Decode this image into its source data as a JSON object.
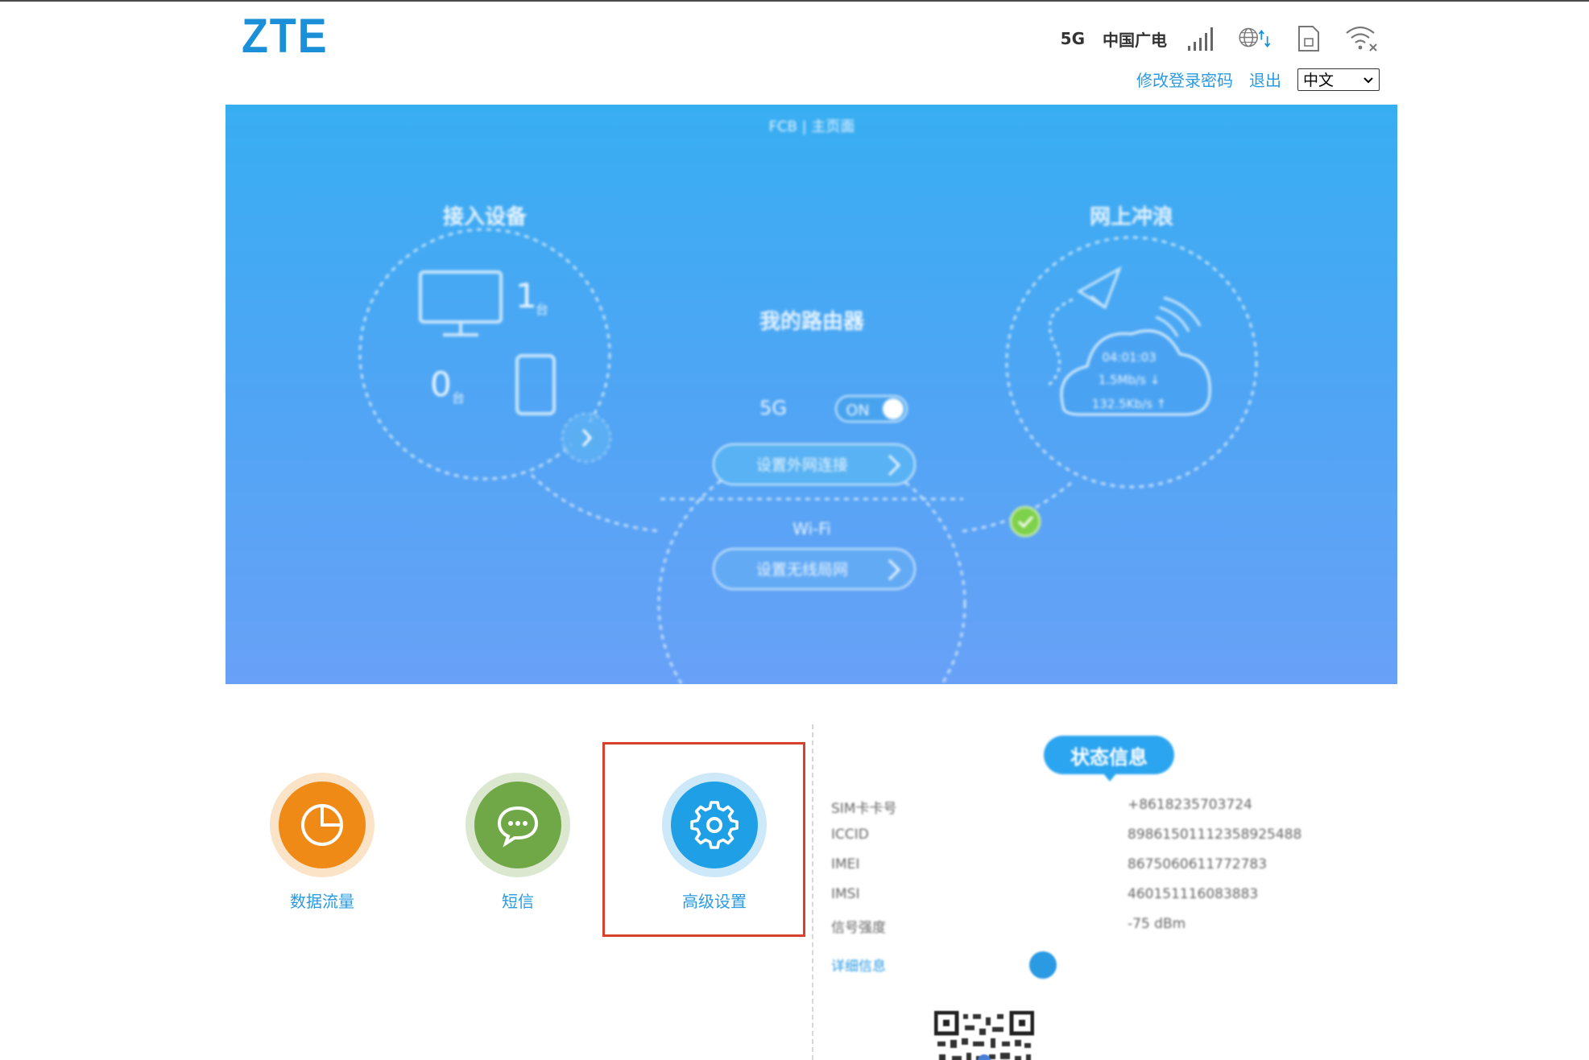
{
  "header": {
    "logo": "ZTE",
    "network_type": "5G",
    "carrier": "中国广电",
    "icons": [
      "signal-icon",
      "internet-globe-icon",
      "sim-card-icon",
      "wifi-icon"
    ],
    "links": {
      "change_password": "修改登录密码",
      "logout": "退出"
    },
    "language": {
      "selected": "中文"
    }
  },
  "banner": {
    "top_text": "FCB | 主页面",
    "devices": {
      "title": "接入设备",
      "wired_count": "1",
      "wired_unit": "台",
      "wireless_count": "0",
      "wireless_unit": "台"
    },
    "router": {
      "title": "我的路由器",
      "band": "5G",
      "toggle": "ON",
      "wan_button": "设置外网连接",
      "wifi_label": "Wi-Fi",
      "wifi_button": "设置无线局网"
    },
    "internet": {
      "title": "网上冲浪",
      "duration": "04:01:03",
      "upload": "1.5Mb/s ↓",
      "download": "132.5Kb/s ↑"
    }
  },
  "tiles": [
    {
      "label": "数据流量",
      "icon": "pie-chart-icon",
      "color": "#ef8a17",
      "ring": "#fbe3c7"
    },
    {
      "label": "短信",
      "icon": "chat-bubble-icon",
      "color": "#71a847",
      "ring": "#dbe8cf"
    },
    {
      "label": "高级设置",
      "icon": "gear-icon",
      "color": "#1fa0e6",
      "ring": "#cde8f8"
    }
  ],
  "status_info": {
    "title": "状态信息",
    "rows": [
      {
        "key": "SIM卡卡号",
        "value": "+8618235703724"
      },
      {
        "key": "ICCID",
        "value": "89861501112358925488"
      },
      {
        "key": "IMEI",
        "value": "8675060611772783"
      },
      {
        "key": "IMSI",
        "value": "460151116083883"
      },
      {
        "key": "信号强度",
        "value": "-75 dBm"
      }
    ],
    "more_label": "详细信息"
  },
  "colors": {
    "accent": "#2a9ae2",
    "highlight_border": "#d9412c",
    "banner_top": "#38aef2",
    "banner_bottom": "#68a1f7"
  }
}
